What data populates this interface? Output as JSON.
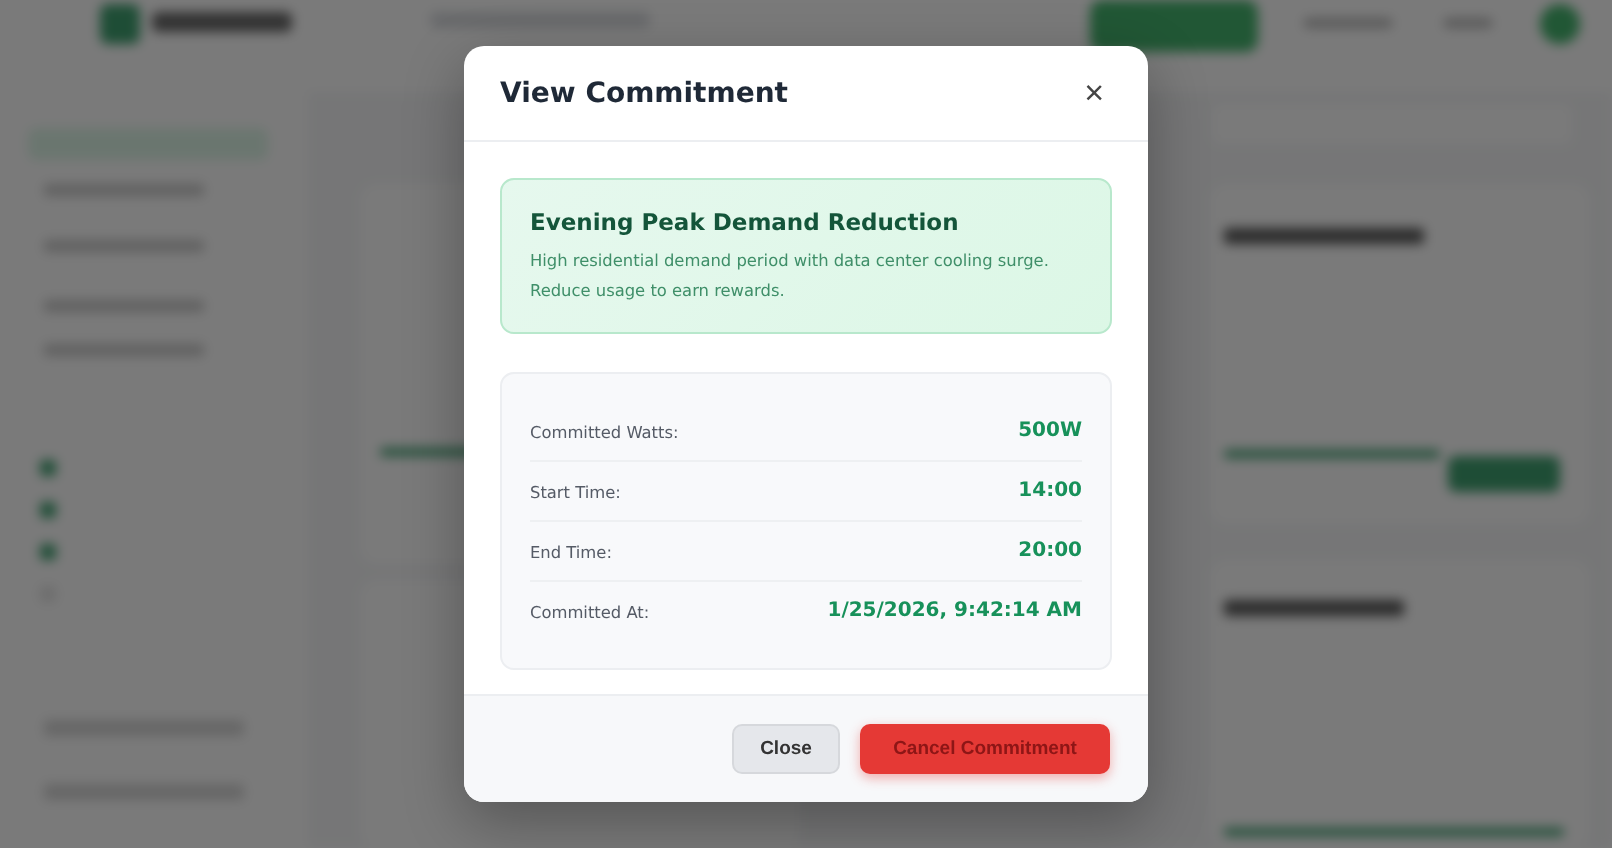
{
  "dialog": {
    "title": "View Commitment",
    "close_icon": "×",
    "event": {
      "title": "Evening Peak Demand Reduction",
      "description": "High residential demand period with data center cooling surge. Reduce usage to earn rewards."
    },
    "details": [
      {
        "label": "Committed Watts:",
        "value": "500W"
      },
      {
        "label": "Start Time:",
        "value": "14:00"
      },
      {
        "label": "End Time:",
        "value": "20:00"
      },
      {
        "label": "Committed At:",
        "value": "1/25/2026, 9:42:14 AM"
      }
    ],
    "buttons": [
      {
        "label": "Close",
        "kind": "secondary"
      },
      {
        "label": "Cancel Commitment",
        "kind": "danger"
      }
    ]
  }
}
